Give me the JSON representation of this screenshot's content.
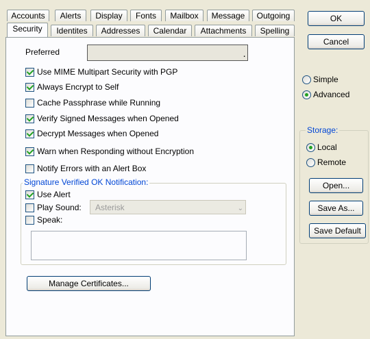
{
  "tabs_row1": [
    "Accounts",
    "Alerts",
    "Display",
    "Fonts",
    "Mailbox",
    "Message",
    "Outgoing"
  ],
  "tabs_row2": [
    "Security",
    "Identites",
    "Addresses",
    "Calendar",
    "Attachments",
    "Spelling"
  ],
  "active_tab": "Security",
  "security": {
    "preferred_label": "Preferred",
    "preferred_value": "",
    "options": [
      {
        "label": "Use MIME Multipart Security with PGP",
        "checked": true
      },
      {
        "label": "Always Encrypt to Self",
        "checked": true
      },
      {
        "label": "Cache Passphrase while Running",
        "checked": false
      },
      {
        "label": "Verify Signed Messages when Opened",
        "checked": true
      },
      {
        "label": "Decrypt Messages when Opened",
        "checked": true
      },
      {
        "label": "Warn when Responding without Encryption",
        "checked": true
      },
      {
        "label": "Notify Errors with an Alert Box",
        "checked": false
      }
    ],
    "notification": {
      "title": "Signature Verified OK Notification:",
      "use_alert": {
        "label": "Use Alert",
        "checked": true
      },
      "play_sound": {
        "label": "Play Sound:",
        "checked": false,
        "value": "Asterisk"
      },
      "speak": {
        "label": "Speak:",
        "checked": false
      },
      "speak_text": ""
    },
    "manage_certificates": "Manage Certificates..."
  },
  "side": {
    "ok": "OK",
    "cancel": "Cancel",
    "mode": [
      {
        "label": "Simple",
        "checked": false
      },
      {
        "label": "Advanced",
        "checked": true
      }
    ],
    "storage_title": "Storage:",
    "storage": [
      {
        "label": "Local",
        "checked": true
      },
      {
        "label": "Remote",
        "checked": false
      }
    ],
    "open": "Open...",
    "save_as": "Save As...",
    "save_default": "Save Default"
  },
  "colors": {
    "accent": "#0046d5",
    "check": "#21a121",
    "background": "#ece9d8"
  }
}
